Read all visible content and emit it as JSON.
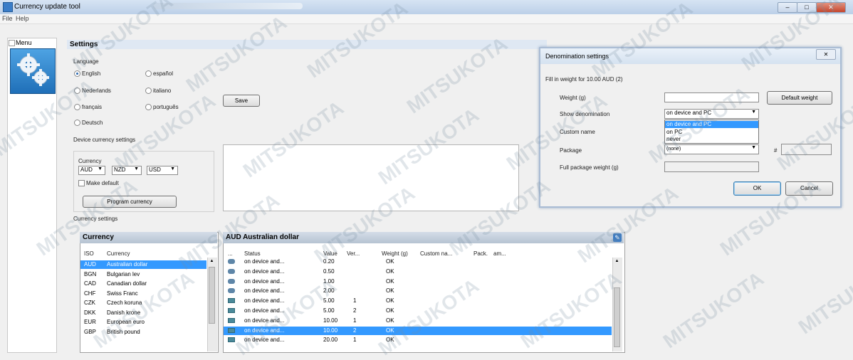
{
  "window": {
    "title": "Currency update tool",
    "controls": {
      "minimize": "–",
      "maximize": "□",
      "close": "✕"
    }
  },
  "menubar": {
    "items": [
      "File",
      "Help"
    ]
  },
  "sidebar": {
    "label": "Menu",
    "tile_icon": "gears-icon"
  },
  "settings": {
    "heading": "Settings",
    "language_label": "Language",
    "languages": [
      {
        "label": "English",
        "selected": true
      },
      {
        "label": "español",
        "selected": false
      },
      {
        "label": "Nederlands",
        "selected": false
      },
      {
        "label": "italiano",
        "selected": false
      },
      {
        "label": "français",
        "selected": false
      },
      {
        "label": "português",
        "selected": false
      },
      {
        "label": "Deutsch",
        "selected": false
      }
    ],
    "save_label": "Save",
    "device_currency_label": "Device currency settings",
    "currency_label": "Currency",
    "currency_combos": [
      "AUD",
      "NZD",
      "USD"
    ],
    "make_default_label": "Make default",
    "program_currency_label": "Program currency",
    "currency_settings_label": "Currency settings"
  },
  "currency_list": {
    "title": "Currency",
    "headers": [
      "ISO",
      "Currency"
    ],
    "rows": [
      {
        "iso": "AUD",
        "name": "Australian dollar",
        "selected": true
      },
      {
        "iso": "BGN",
        "name": "Bulgarian lev",
        "selected": false
      },
      {
        "iso": "CAD",
        "name": "Canadian dollar",
        "selected": false
      },
      {
        "iso": "CHF",
        "name": "Swiss Franc",
        "selected": false
      },
      {
        "iso": "CZK",
        "name": "Czech koruna",
        "selected": false
      },
      {
        "iso": "DKK",
        "name": "Danish krone",
        "selected": false
      },
      {
        "iso": "EUR",
        "name": "European euro",
        "selected": false
      },
      {
        "iso": "GBP",
        "name": "British pound",
        "selected": false
      }
    ]
  },
  "denom_table": {
    "title": "AUD Australian dollar",
    "headers": [
      "...",
      "Status",
      "Value",
      "Ver...",
      "Weight (g)",
      "Custom na...",
      "Pack.",
      "am..."
    ],
    "rows": [
      {
        "kind": "coin",
        "status": "on device and...",
        "value": "0.20",
        "ver": "",
        "weight": "OK",
        "selected": false
      },
      {
        "kind": "coin",
        "status": "on device and...",
        "value": "0.50",
        "ver": "",
        "weight": "OK",
        "selected": false
      },
      {
        "kind": "coin",
        "status": "on device and...",
        "value": "1.00",
        "ver": "",
        "weight": "OK",
        "selected": false
      },
      {
        "kind": "coin",
        "status": "on device and...",
        "value": "2.00",
        "ver": "",
        "weight": "OK",
        "selected": false
      },
      {
        "kind": "note",
        "status": "on device and...",
        "value": "5.00",
        "ver": "1",
        "weight": "OK",
        "selected": false
      },
      {
        "kind": "note",
        "status": "on device and...",
        "value": "5.00",
        "ver": "2",
        "weight": "OK",
        "selected": false
      },
      {
        "kind": "note",
        "status": "on device and...",
        "value": "10.00",
        "ver": "1",
        "weight": "OK",
        "selected": false
      },
      {
        "kind": "note",
        "status": "on device and...",
        "value": "10.00",
        "ver": "2",
        "weight": "OK",
        "selected": true
      },
      {
        "kind": "note",
        "status": "on device and...",
        "value": "20.00",
        "ver": "1",
        "weight": "OK",
        "selected": false
      }
    ]
  },
  "dialog": {
    "title": "Denomination settings",
    "close": "✕",
    "subtitle": "Fill in weight for 10.00 AUD (2)",
    "weight_label": "Weight (g)",
    "weight_value": "",
    "default_weight_label": "Default weight",
    "show_label": "Show denomination",
    "show_value": "on device and PC",
    "show_options": [
      "on device and PC",
      "on PC",
      "never"
    ],
    "custom_name_label": "Custom name",
    "package_label": "Package",
    "package_value": "(none)",
    "hash": "#",
    "full_weight_label": "Full package weight (g)",
    "ok_label": "OK",
    "cancel_label": "Cancel"
  },
  "watermark_text": "MITSUKOTA"
}
